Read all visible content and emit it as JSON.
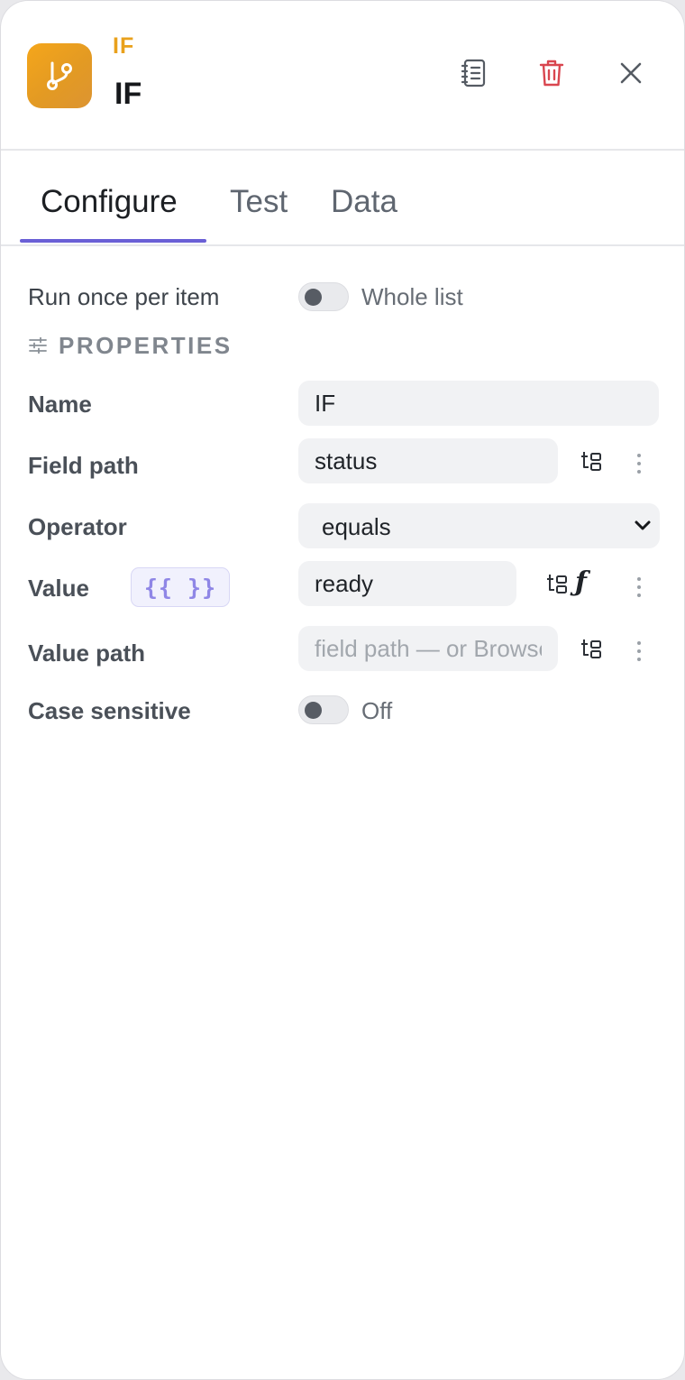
{
  "header": {
    "node_type": "IF",
    "node_title": "IF",
    "icons": {
      "node": "git-branch-icon",
      "docs": "notebook-icon",
      "delete": "trash-icon",
      "close": "close-icon"
    },
    "colors": {
      "accent": "#e9a11c",
      "delete": "#d9464f"
    }
  },
  "tabs": [
    {
      "label": "Configure",
      "active": true
    },
    {
      "label": "Test",
      "active": false
    },
    {
      "label": "Data",
      "active": false
    }
  ],
  "run_mode": {
    "label": "Run once per item",
    "toggle_text": "Whole list",
    "on": false
  },
  "properties": {
    "section_title": "PROPERTIES",
    "name": {
      "label": "Name",
      "value": "IF"
    },
    "field_path": {
      "label": "Field path",
      "value": "status"
    },
    "operator": {
      "label": "Operator",
      "value": "equals"
    },
    "value": {
      "label": "Value",
      "expression_badge": "{{ }}",
      "input": "ready",
      "fx": "ƒ"
    },
    "value_path": {
      "label": "Value path",
      "value": "",
      "placeholder": "field path — or Browse"
    },
    "case_sensitive": {
      "label": "Case sensitive",
      "toggle_text": "Off",
      "on": false
    }
  }
}
